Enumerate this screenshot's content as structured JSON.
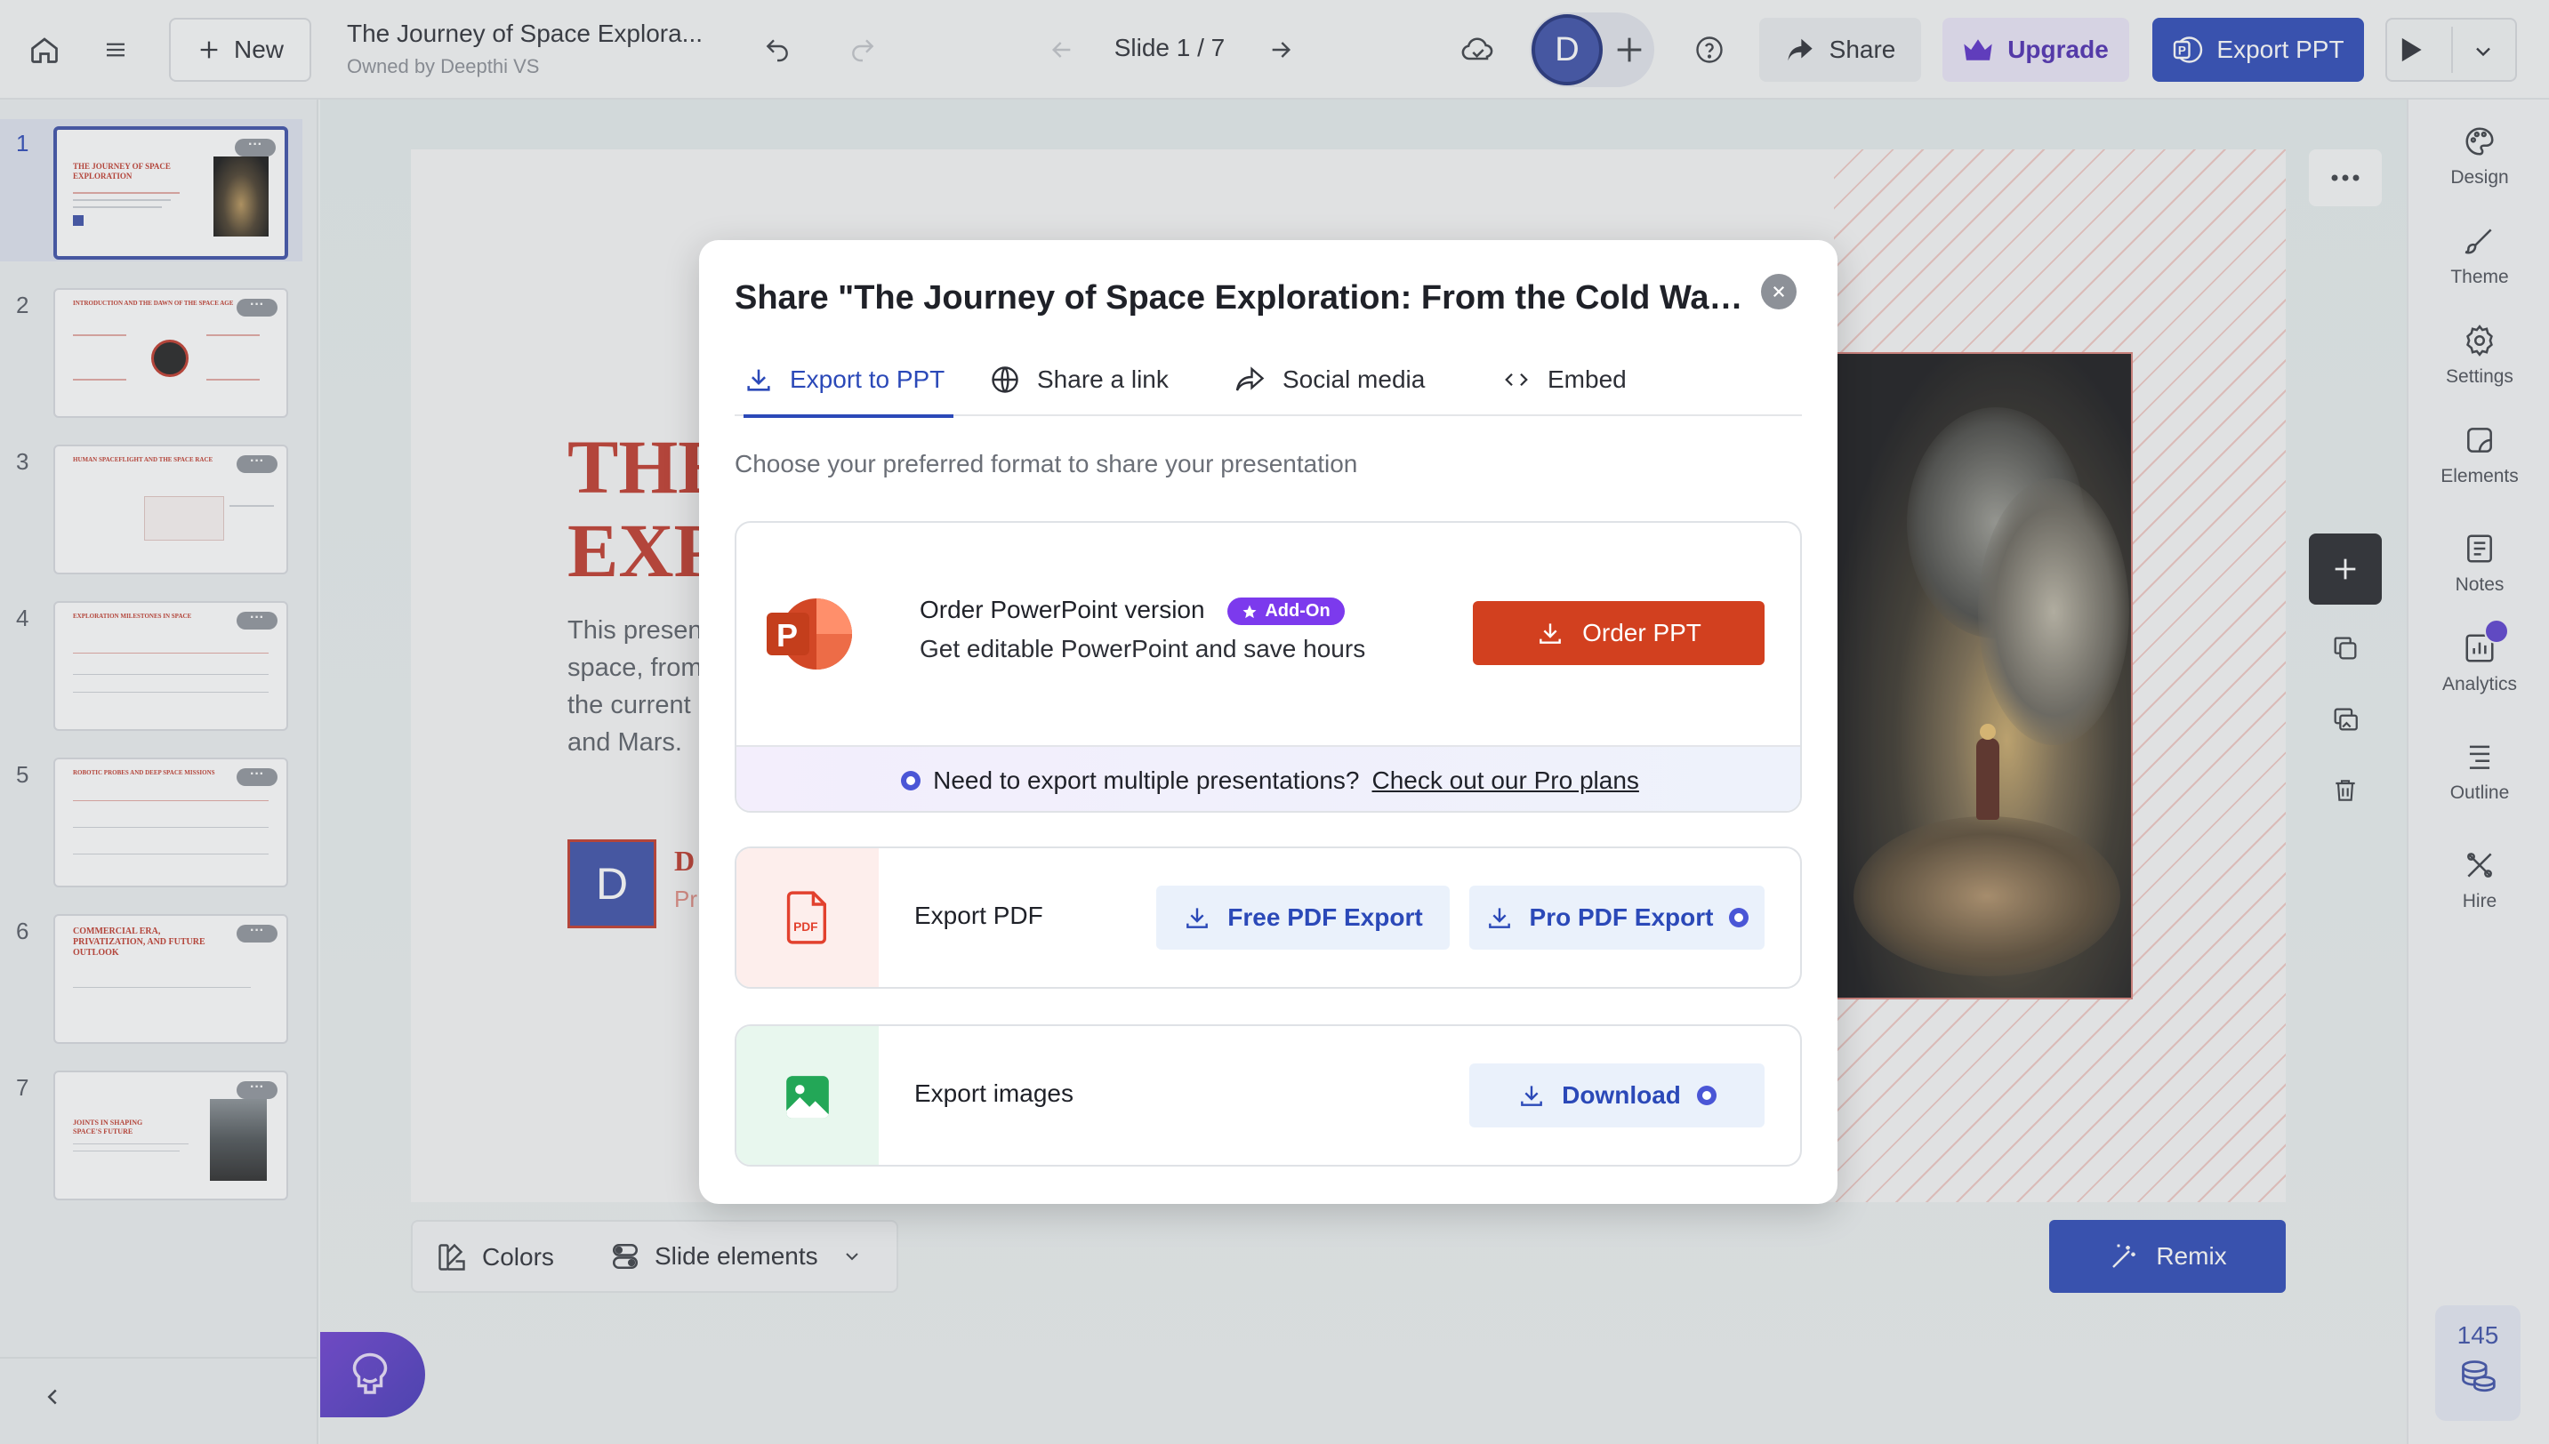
{
  "topbar": {
    "new_label": "New",
    "doc_title": "The Journey of Space Explora...",
    "doc_owner": "Owned by Deepthi VS",
    "slide_counter": "Slide 1 / 7",
    "avatar_initial": "D",
    "share_label": "Share",
    "upgrade_label": "Upgrade",
    "export_label": "Export PPT"
  },
  "thumbnails": [
    {
      "num": "1",
      "title": "THE JOURNEY OF SPACE EXPLORATION"
    },
    {
      "num": "2",
      "title": "INTRODUCTION AND THE DAWN OF THE SPACE AGE"
    },
    {
      "num": "3",
      "title": "HUMAN SPACEFLIGHT AND THE SPACE RACE"
    },
    {
      "num": "4",
      "title": "EXPLORATION MILESTONES IN SPACE"
    },
    {
      "num": "5",
      "title": "ROBOTIC PROBES AND DEEP SPACE MISSIONS"
    },
    {
      "num": "6",
      "title": "COMMERCIAL ERA, PRIVATIZATION, AND FUTURE OUTLOOK"
    },
    {
      "num": "7",
      "title": "JOINTS IN SHAPING SPACE'S FUTURE"
    }
  ],
  "slide": {
    "title_line1": "THE",
    "title_line2": "EXP",
    "body_lines": [
      "This presen",
      "space, from",
      "the current",
      "and Mars."
    ],
    "author_initial": "D",
    "author_name": "D",
    "author_role": "Pr"
  },
  "rightrail": [
    {
      "label": "Design",
      "icon": "palette-icon"
    },
    {
      "label": "Theme",
      "icon": "brush-icon"
    },
    {
      "label": "Settings",
      "icon": "gear-icon"
    },
    {
      "label": "Elements",
      "icon": "elements-icon"
    },
    {
      "label": "Notes",
      "icon": "notes-icon"
    },
    {
      "label": "Analytics",
      "icon": "analytics-icon"
    },
    {
      "label": "Outline",
      "icon": "outline-icon"
    },
    {
      "label": "Hire",
      "icon": "hire-icon"
    }
  ],
  "bottombar": {
    "colors_label": "Colors",
    "elements_label": "Slide elements",
    "remix_label": "Remix"
  },
  "credits": {
    "count": "145"
  },
  "modal": {
    "title": "Share \"The Journey of Space Exploration: From the Cold War t...",
    "tabs": [
      "Export to PPT",
      "Share a link",
      "Social media",
      "Embed"
    ],
    "subtitle": "Choose your preferred format to share your presentation",
    "ppt_card": {
      "heading": "Order PowerPoint version",
      "badge": "Add-On",
      "desc": "Get editable PowerPoint and save hours",
      "button": "Order PPT",
      "footer_text": "Need to export multiple presentations?",
      "footer_link": "Check out our Pro plans"
    },
    "pdf_card": {
      "label": "Export PDF",
      "free_button": "Free PDF Export",
      "pro_button": "Pro PDF Export"
    },
    "images_card": {
      "label": "Export images",
      "button": "Download"
    }
  },
  "colors": {
    "accent_blue": "#2b49b8",
    "brand_red": "#c0392b",
    "order_button": "#d2401f",
    "addon_purple": "#7c3aed"
  }
}
